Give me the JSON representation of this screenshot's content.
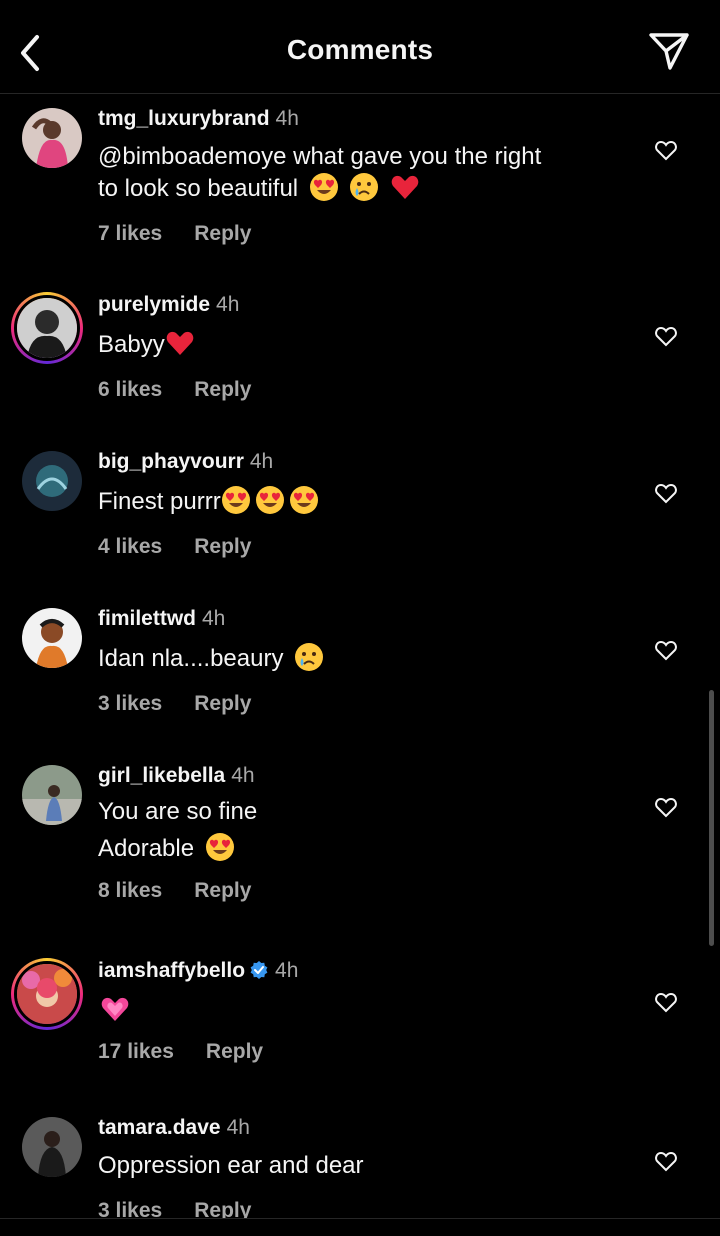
{
  "header": {
    "title": "Comments",
    "back_icon": "chevron-left-icon",
    "share_icon": "paper-plane-icon"
  },
  "comments": [
    {
      "username": "tmg_luxurybrand",
      "time": "4h",
      "lines": [
        "@bimboademoye what gave you the right",
        "to look so beautiful"
      ],
      "emojis": [
        "heart-eyes",
        "crying-face",
        "red-heart"
      ],
      "likes": "7 likes",
      "reply": "Reply",
      "verified": false,
      "story_ring": false
    },
    {
      "username": "purelymide",
      "time": "4h",
      "lines": [
        "Babyy"
      ],
      "emojis": [
        "red-heart"
      ],
      "likes": "6 likes",
      "reply": "Reply",
      "verified": false,
      "story_ring": true
    },
    {
      "username": "big_phayvourr",
      "time": "4h",
      "lines": [
        "Finest purrr"
      ],
      "emojis": [
        "heart-eyes",
        "heart-eyes",
        "heart-eyes"
      ],
      "likes": "4 likes",
      "reply": "Reply",
      "verified": false,
      "story_ring": false
    },
    {
      "username": "fimilettwd",
      "time": "4h",
      "lines": [
        "Idan nla....beaury"
      ],
      "emojis": [
        "crying-face"
      ],
      "likes": "3 likes",
      "reply": "Reply",
      "verified": false,
      "story_ring": false
    },
    {
      "username": "girl_likebella",
      "time": "4h",
      "lines": [
        "You are so fine",
        "Adorable"
      ],
      "emojis": [
        "heart-eyes"
      ],
      "likes": "8 likes",
      "reply": "Reply",
      "verified": false,
      "story_ring": false
    },
    {
      "username": "iamshaffybello",
      "time": "4h",
      "lines": [
        ""
      ],
      "emojis": [
        "growing-heart"
      ],
      "likes": "17 likes",
      "reply": "Reply",
      "verified": true,
      "story_ring": true
    },
    {
      "username": "tamara.dave",
      "time": "4h",
      "lines": [
        "Oppression ear and dear"
      ],
      "emojis": [],
      "likes": "3 likes",
      "reply": "Reply",
      "verified": false,
      "story_ring": false
    }
  ],
  "colors": {
    "background": "#000000",
    "text": "#f5f5f5",
    "secondary": "#a8a8a8",
    "verified": "#3897f0"
  }
}
